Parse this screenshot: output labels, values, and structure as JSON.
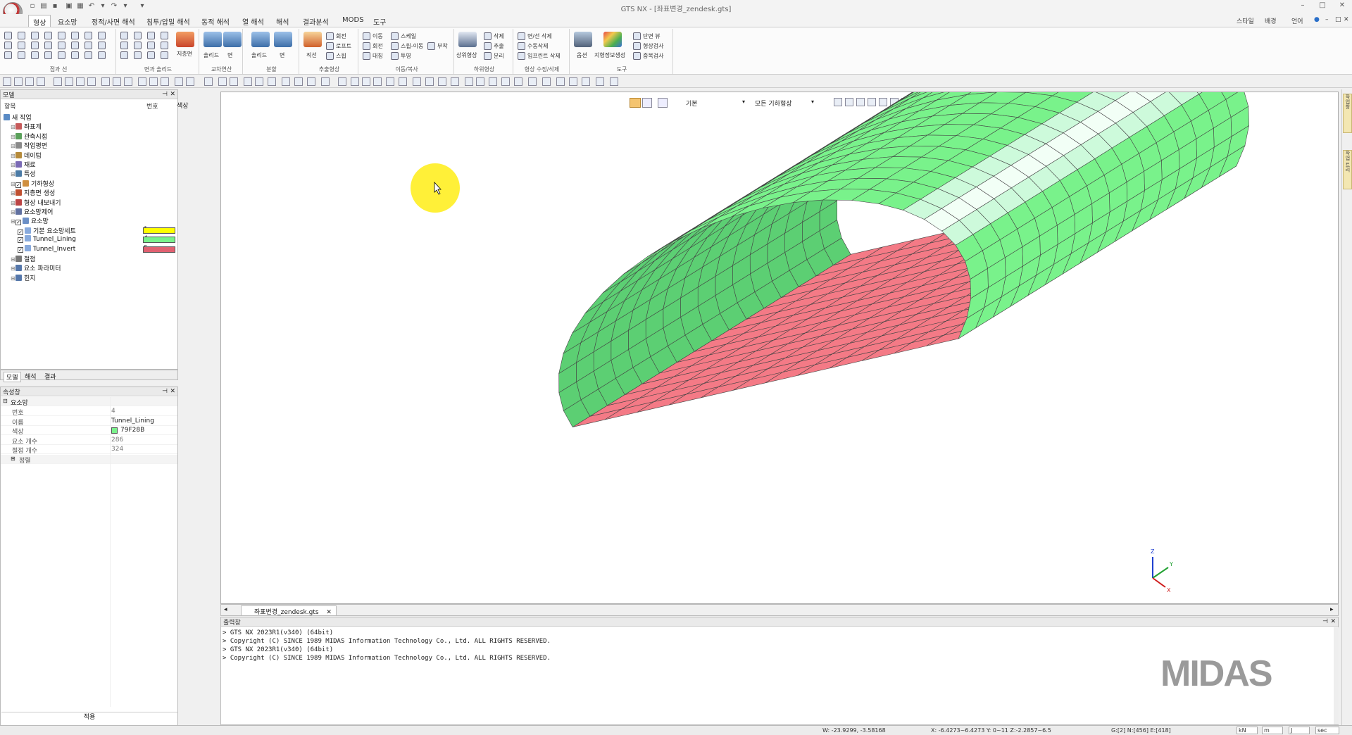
{
  "window": {
    "title": "GTS NX - [좌표변경_zendesk.gts]",
    "right_menu": [
      "스타일",
      "배경",
      "언어"
    ]
  },
  "menu": {
    "tabs": [
      "형상",
      "요소망",
      "정적/사면 해석",
      "침투/압밀 해석",
      "동적 해석",
      "열 해석",
      "해석",
      "결과분석",
      "MODS",
      "도구"
    ],
    "active": "형상"
  },
  "ribbon": {
    "groups": [
      "점과 선",
      "면과 솔리드",
      "교차연산",
      "분할",
      "추출형상",
      "이동/복사",
      "하위형상",
      "형상 수정/삭제",
      "도구"
    ],
    "big_buttons": [
      "지층면",
      "솔리드",
      "면",
      "솔리드",
      "면",
      "직선",
      "상위형상",
      "옵션",
      "지형정보생성"
    ],
    "small_buttons": [
      "회전",
      "로프트",
      "스윕",
      "이동",
      "스케일",
      "회전",
      "스윕-이동",
      "부착",
      "대칭",
      "투영",
      "삭제",
      "추출",
      "분리",
      "면/선 삭제",
      "수동삭제",
      "임프린트 삭제",
      "단면 뷰",
      "형상검사",
      "중복검사"
    ]
  },
  "tree": {
    "header": "모델",
    "columns": [
      "항목",
      "번호",
      "색상"
    ],
    "items": [
      {
        "label": "새 작업",
        "level": 0,
        "number": "",
        "color": ""
      },
      {
        "label": "좌표계",
        "level": 1,
        "number": "",
        "color": ""
      },
      {
        "label": "관측시점",
        "level": 1,
        "number": "",
        "color": ""
      },
      {
        "label": "작업평면",
        "level": 1,
        "number": "",
        "color": ""
      },
      {
        "label": "데이텀",
        "level": 1,
        "number": "",
        "color": ""
      },
      {
        "label": "재료",
        "level": 1,
        "number": "",
        "color": ""
      },
      {
        "label": "특성",
        "level": 1,
        "number": "",
        "color": ""
      },
      {
        "label": "기하형상",
        "level": 1,
        "number": "",
        "color": ""
      },
      {
        "label": "지층면 생성",
        "level": 1,
        "number": "",
        "color": ""
      },
      {
        "label": "형상 내보내기",
        "level": 1,
        "number": "",
        "color": ""
      },
      {
        "label": "요소망제어",
        "level": 1,
        "number": "",
        "color": ""
      },
      {
        "label": "요소망",
        "level": 1,
        "number": "",
        "color": ""
      },
      {
        "label": "기본 요소망세트",
        "level": 2,
        "number": "1",
        "color": "#FFFF00"
      },
      {
        "label": "Tunnel_Lining",
        "level": 2,
        "number": "4",
        "color": "#79F28B"
      },
      {
        "label": "Tunnel_Invert",
        "level": 2,
        "number": "5",
        "color": "#E06070"
      },
      {
        "label": "절점",
        "level": 1,
        "number": "",
        "color": ""
      },
      {
        "label": "요소 파라미터",
        "level": 1,
        "number": "",
        "color": ""
      },
      {
        "label": "힌지",
        "level": 1,
        "number": "",
        "color": ""
      }
    ]
  },
  "panel_tabs": [
    "모델",
    "해석",
    "결과"
  ],
  "properties": {
    "header": "속성창",
    "section": "요소망",
    "rows": [
      {
        "key": "번호",
        "value": "4"
      },
      {
        "key": "이름",
        "value": "Tunnel_Lining"
      },
      {
        "key": "색상",
        "value": "79F28B"
      },
      {
        "key": "요소 개수",
        "value": "286"
      },
      {
        "key": "절점 개수",
        "value": "324"
      },
      {
        "key": "정렬",
        "value": ""
      }
    ],
    "apply_label": "적용",
    "swatch_color": "#79F28B"
  },
  "viewport": {
    "toolbar_style": "기본",
    "toolbar_filter": "모든 기하형상"
  },
  "model_colors": {
    "lining": "#79F28B",
    "lining_dark": "#5ccf73",
    "lining_light": "#cdfadb",
    "invert": "#F47A86",
    "edge": "#444444"
  },
  "axes": {
    "x": "X",
    "y": "Y",
    "z": "Z"
  },
  "doc_tab": "좌표변경_zendesk.gts",
  "output": {
    "header": "출력창",
    "lines": [
      "> GTS NX 2023R1(v340) (64bit)",
      "> Copyright (C) SINCE 1989 MIDAS Information Technology Co., Ltd. ALL RIGHTS RESERVED.",
      "> GTS NX 2023R1(v340) (64bit)",
      "> Copyright (C) SINCE 1989 MIDAS Information Technology Co., Ltd. ALL RIGHTS RESERVED."
    ],
    "watermark": "MIDAS"
  },
  "status": {
    "w": "W: -23.9299, -3.58168",
    "xyz": "X: -6.4273~6.4273 Y: 0~11 Z:-2.2857~6.5",
    "counts": "G:[2] N:[456] E:[418]",
    "unit_force": "kN",
    "unit_length": "m",
    "unit_energy": "J",
    "unit_time": "sec"
  },
  "right_tabs": [
    "작업창",
    "작업 트리"
  ]
}
